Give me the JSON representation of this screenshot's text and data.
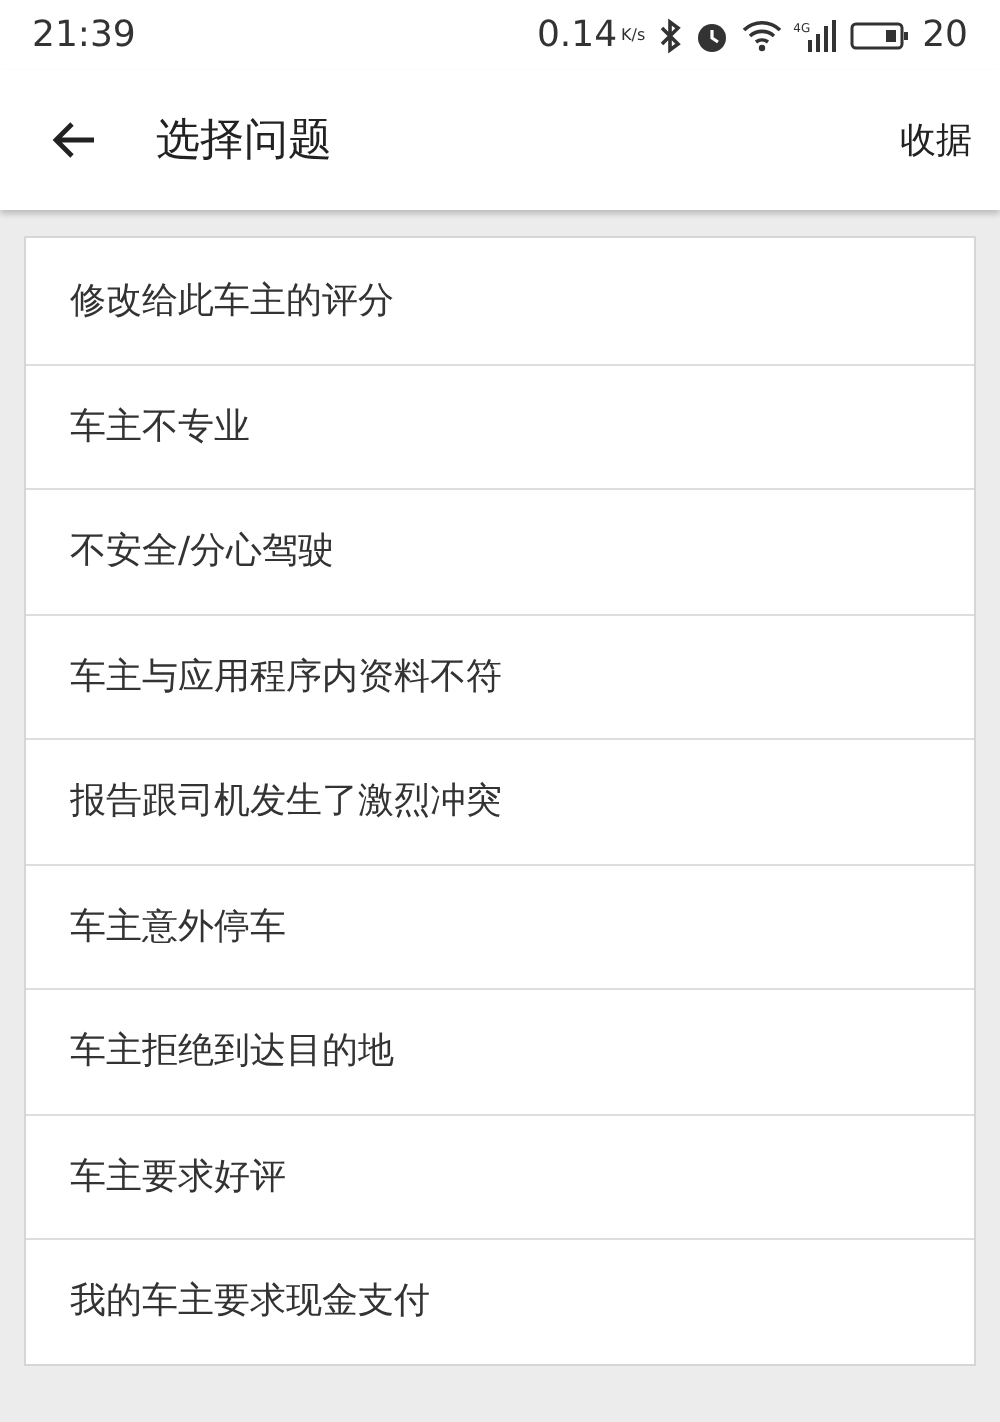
{
  "status_bar": {
    "time": "21:39",
    "speed": "0.14",
    "speed_unit": "K/s",
    "network": "4G",
    "battery": "20"
  },
  "header": {
    "title": "选择问题",
    "action": "收据"
  },
  "issues": [
    {
      "label": "修改给此车主的评分"
    },
    {
      "label": "车主不专业"
    },
    {
      "label": "不安全/分心驾驶"
    },
    {
      "label": "车主与应用程序内资料不符"
    },
    {
      "label": "报告跟司机发生了激烈冲突"
    },
    {
      "label": "车主意外停车"
    },
    {
      "label": "车主拒绝到达目的地"
    },
    {
      "label": "车主要求好评"
    },
    {
      "label": "我的车主要求现金支付"
    }
  ]
}
